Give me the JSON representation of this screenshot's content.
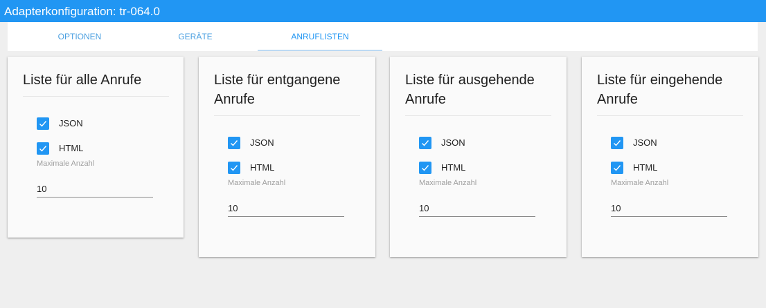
{
  "window": {
    "title": "Adapterkonfiguration: tr-064.0"
  },
  "tabs": [
    {
      "label": "OPTIONEN"
    },
    {
      "label": "GERÄTE"
    },
    {
      "label": "ANRUFLISTEN"
    }
  ],
  "active_tab": "ANRUFLISTEN",
  "accent_color": "#2196f3",
  "cards": [
    {
      "title": "Liste für alle Anrufe",
      "json_label": "JSON",
      "json_checked": true,
      "html_label": "HTML",
      "html_checked": true,
      "max_label": "Maximale Anzahl",
      "max_value": "10"
    },
    {
      "title": "Liste für entgangene Anrufe",
      "json_label": "JSON",
      "json_checked": true,
      "html_label": "HTML",
      "html_checked": true,
      "max_label": "Maximale Anzahl",
      "max_value": "10"
    },
    {
      "title": "Liste für ausgehende Anrufe",
      "json_label": "JSON",
      "json_checked": true,
      "html_label": "HTML",
      "html_checked": true,
      "max_label": "Maximale Anzahl",
      "max_value": "10"
    },
    {
      "title": "Liste für eingehende Anrufe",
      "json_label": "JSON",
      "json_checked": true,
      "html_label": "HTML",
      "html_checked": true,
      "max_label": "Maximale Anzahl",
      "max_value": "10"
    }
  ]
}
